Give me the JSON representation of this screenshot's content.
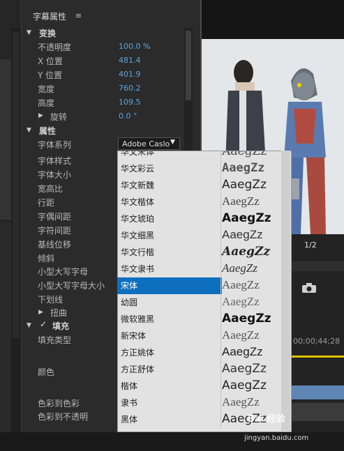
{
  "panel": {
    "title": "字幕属性",
    "menu_icon": "≡",
    "transform": {
      "label": "变换",
      "opacity": {
        "label": "不透明度",
        "value": "100.0 %"
      },
      "x": {
        "label": "X 位置",
        "value": "481.4"
      },
      "y": {
        "label": "Y 位置",
        "value": "401.9"
      },
      "width": {
        "label": "宽度",
        "value": "760.2"
      },
      "height": {
        "label": "高度",
        "value": "109.5"
      },
      "rotation": {
        "label": "旋转",
        "value": "0.0 °"
      }
    },
    "properties": {
      "label": "属性",
      "font_family": {
        "label": "字体系列",
        "value": "Adobe Caslo"
      },
      "font_style": "字体样式",
      "font_size": "字体大小",
      "aspect": "宽高比",
      "leading": "行距",
      "kerning": "字偶间距",
      "tracking": "字符间距",
      "baseline": "基线位移",
      "slant": "倾斜",
      "small_caps": "小型大写字母",
      "small_caps_size": "小型大写字母大小",
      "underline": "下划线",
      "distort": "扭曲"
    },
    "fill": {
      "label": "填充",
      "checkbox": "✓",
      "fill_type": "填充类型",
      "color": "颜色",
      "color_to_color": "色彩到色彩",
      "color_to_opacity": "色彩到不透明"
    }
  },
  "dropdown": {
    "items": [
      {
        "name": "华文宋体",
        "sample": "AaegZz"
      },
      {
        "name": "华文彩云",
        "sample": "AaegZz"
      },
      {
        "name": "华文新魏",
        "sample": "AaegZz"
      },
      {
        "name": "华文楷体",
        "sample": "AaegZz"
      },
      {
        "name": "华文琥珀",
        "sample": "AaegZz"
      },
      {
        "name": "华文细黑",
        "sample": "AaegZz"
      },
      {
        "name": "华文行楷",
        "sample": "AaegZz"
      },
      {
        "name": "华文隶书",
        "sample": "AaegZz"
      },
      {
        "name": "宋体",
        "sample": "AaegZz",
        "selected": true
      },
      {
        "name": "幼圆",
        "sample": "AaegZz"
      },
      {
        "name": "微软雅黑",
        "sample": "AaegZz"
      },
      {
        "name": "新宋体",
        "sample": "AaegZz"
      },
      {
        "name": "方正姚体",
        "sample": "AaegZz"
      },
      {
        "name": "方正舒体",
        "sample": "AaegZz"
      },
      {
        "name": "楷体",
        "sample": "AaegZz"
      },
      {
        "name": "隶书",
        "sample": "AaegZz"
      },
      {
        "name": "黑体",
        "sample": "AaegZz"
      }
    ]
  },
  "preview": {
    "zoom": "1/2",
    "timecode": "00;00;44;28"
  },
  "watermark": {
    "brand": "Bai 经验",
    "url": "jingyan.baidu.com"
  },
  "colors": {
    "accent": "#0f6fbf",
    "value_blue": "#5da4dc",
    "timeline_yellow": "#e2c500",
    "track_blue": "#5e86b4"
  }
}
